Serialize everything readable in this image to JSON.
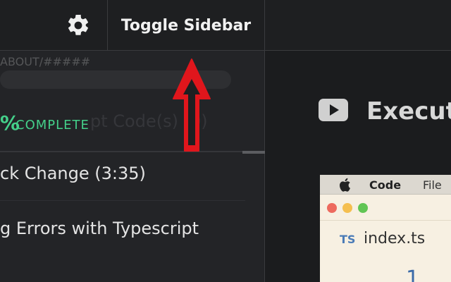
{
  "topbar": {
    "settings_icon": "gear-icon",
    "toggle_label": "Toggle Sidebar"
  },
  "sidebar": {
    "course_meta": "ABOUT/#####",
    "progress": {
      "percent_text": "%",
      "complete_text": "COMPLETE",
      "ghost_text": "pt Code(s) (0)"
    },
    "lessons": [
      {
        "label": "ck Change (3:35)"
      },
      {
        "label": "g Errors with Typescript"
      }
    ]
  },
  "annotation": {
    "arrow_color": "#e0161c",
    "arrow_icon": "up-arrow-icon"
  },
  "main": {
    "video_icon": "play-video-icon",
    "title": "Execut",
    "thumbnail": {
      "menu_items": [
        "Code",
        "File"
      ],
      "file_badge": "TS",
      "file_name": "index.ts",
      "line_number": "1"
    }
  },
  "colors": {
    "accent_green": "#44d08a",
    "background": "#1c1d1f",
    "sidebar_bg": "#232427"
  }
}
